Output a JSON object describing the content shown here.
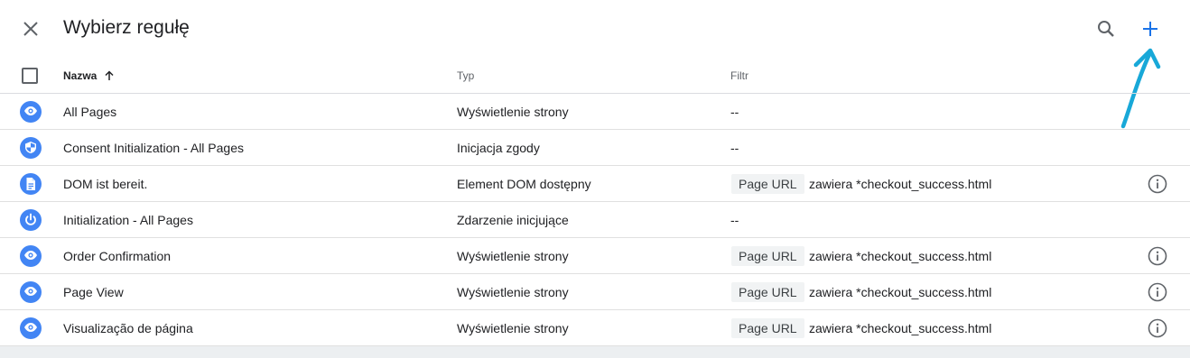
{
  "header": {
    "title": "Wybierz regułę",
    "close_icon": "close-icon",
    "search_icon": "search-icon",
    "add_icon": "plus-icon",
    "accent_color": "#1a73e8",
    "annotation_color": "#18a8d8"
  },
  "table": {
    "columns": {
      "name": "Nazwa",
      "type": "Typ",
      "filter": "Filtr"
    },
    "sort": "ascending",
    "rows": [
      {
        "icon": "eye-icon",
        "name": "All Pages",
        "type": "Wyświetlenie strony",
        "filter_empty": "--"
      },
      {
        "icon": "shield-icon",
        "name": "Consent Initialization - All Pages",
        "type": "Inicjacja zgody",
        "filter_empty": "--"
      },
      {
        "icon": "document-icon",
        "name": "DOM ist bereit.",
        "type": "Element DOM dostępny",
        "filter_var": "Page URL",
        "filter_cond": "zawiera *checkout_success.html"
      },
      {
        "icon": "power-icon",
        "name": "Initialization - All Pages",
        "type": "Zdarzenie inicjujące",
        "filter_empty": "--"
      },
      {
        "icon": "eye-icon",
        "name": "Order Confirmation",
        "type": "Wyświetlenie strony",
        "filter_var": "Page URL",
        "filter_cond": "zawiera *checkout_success.html"
      },
      {
        "icon": "eye-icon",
        "name": "Page View",
        "type": "Wyświetlenie strony",
        "filter_var": "Page URL",
        "filter_cond": "zawiera *checkout_success.html"
      },
      {
        "icon": "eye-icon",
        "name": "Visualização de página",
        "type": "Wyświetlenie strony",
        "filter_var": "Page URL",
        "filter_cond": "zawiera *checkout_success.html"
      }
    ],
    "icon_color": "#4285f4"
  }
}
